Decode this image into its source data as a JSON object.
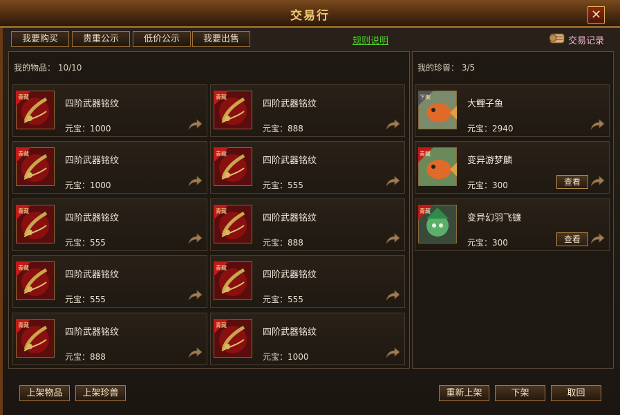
{
  "title": "交易行",
  "tabs": [
    "我要购买",
    "贵重公示",
    "低价公示",
    "我要出售"
  ],
  "rules_link": "规则说明",
  "trade_record": "交易记录",
  "items_panel": {
    "label": "我的物品：",
    "count": "10/10"
  },
  "pets_panel": {
    "label": "我的珍兽：",
    "count": "3/5"
  },
  "currency_label": "元宝：",
  "items": [
    {
      "name": "四阶武器铭纹",
      "price": "1000"
    },
    {
      "name": "四阶武器铭纹",
      "price": "888"
    },
    {
      "name": "四阶武器铭纹",
      "price": "1000"
    },
    {
      "name": "四阶武器铭纹",
      "price": "555"
    },
    {
      "name": "四阶武器铭纹",
      "price": "555"
    },
    {
      "name": "四阶武器铭纹",
      "price": "888"
    },
    {
      "name": "四阶武器铭纹",
      "price": "555"
    },
    {
      "name": "四阶武器铭纹",
      "price": "555"
    },
    {
      "name": "四阶武器铭纹",
      "price": "888"
    },
    {
      "name": "四阶武器铭纹",
      "price": "1000"
    }
  ],
  "item_badge": "青藏",
  "pets": [
    {
      "name": "大鲤子鱼",
      "price": "2940",
      "badge": "下架"
    },
    {
      "name": "变异游梦麟",
      "price": "300",
      "badge": "青藏",
      "view": "查看"
    },
    {
      "name": "变异幻羽飞镰",
      "price": "300",
      "badge": "青藏",
      "view": "查看"
    }
  ],
  "bottom_left": [
    "上架物品",
    "上架珍兽"
  ],
  "bottom_right": [
    "重新上架",
    "下架",
    "取回"
  ],
  "close_symbol": "✕"
}
